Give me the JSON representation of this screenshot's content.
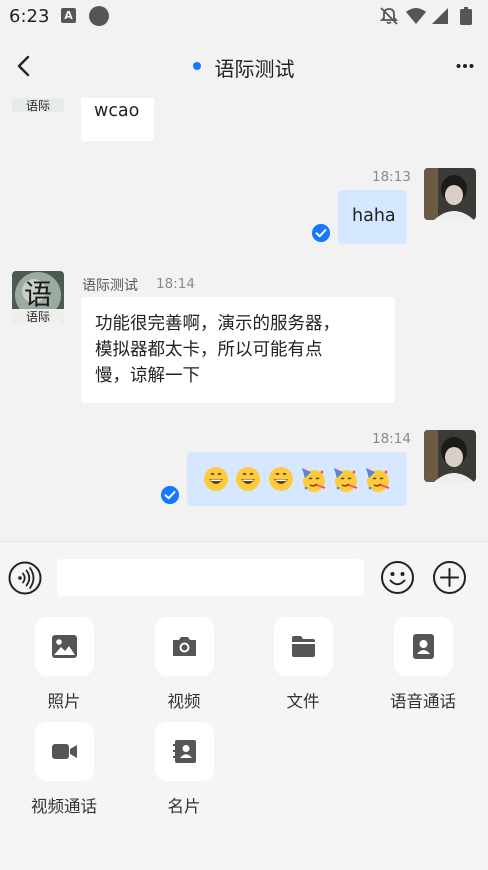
{
  "status_bar": {
    "time": "6:23",
    "left_icons": [
      "font-a-icon",
      "circle-icon"
    ],
    "right_icons": [
      "bell-off-icon",
      "wifi-icon",
      "signal-icon",
      "battery-icon"
    ]
  },
  "header": {
    "title": "语际测试",
    "online_indicator_color": "#1677ff",
    "back_icon": "chevron-left-icon",
    "more_icon": "more-dots-icon"
  },
  "messages": [
    {
      "direction": "incoming",
      "avatar": "contact-avatar",
      "text": "wcao"
    },
    {
      "direction": "outgoing",
      "time": "18:13",
      "avatar": "user-avatar",
      "text": "haha",
      "read": true
    },
    {
      "direction": "incoming",
      "sender": "语际测试",
      "time": "18:14",
      "avatar": "contact-avatar",
      "text": "功能很完善啊，演示的服务器，模拟器都太卡，所以可能有点慢，谅解一下"
    },
    {
      "direction": "outgoing",
      "time": "18:14",
      "avatar": "user-avatar",
      "emojis": [
        "grinning-face-emoji",
        "grinning-face-emoji",
        "grinning-face-emoji",
        "partying-face-emoji",
        "partying-face-emoji",
        "partying-face-emoji"
      ],
      "read": true
    }
  ],
  "avatar_text": {
    "contact_big": "语",
    "contact_small": "语际"
  },
  "message_lines": {
    "m3": [
      "功能很完善啊，演示的服务器，",
      "模拟器都太卡，所以可能有点",
      "慢，谅解一下"
    ]
  },
  "input_bar": {
    "voice_icon": "voice-wave-icon",
    "input_value": "",
    "emoji_icon": "smiley-icon",
    "plus_icon": "plus-circle-icon"
  },
  "tools": [
    {
      "label": "照片",
      "icon": "photo-icon"
    },
    {
      "label": "视频",
      "icon": "camera-icon"
    },
    {
      "label": "文件",
      "icon": "folder-icon"
    },
    {
      "label": "语音通话",
      "icon": "voice-call-icon"
    },
    {
      "label": "视频通话",
      "icon": "video-call-icon"
    },
    {
      "label": "名片",
      "icon": "contact-card-icon"
    }
  ],
  "colors": {
    "accent": "#1677ff",
    "outgoing_bubble": "#d6e8ff",
    "incoming_bubble": "#ffffff",
    "background": "#f2f2f3",
    "icon_gray": "#555555"
  }
}
